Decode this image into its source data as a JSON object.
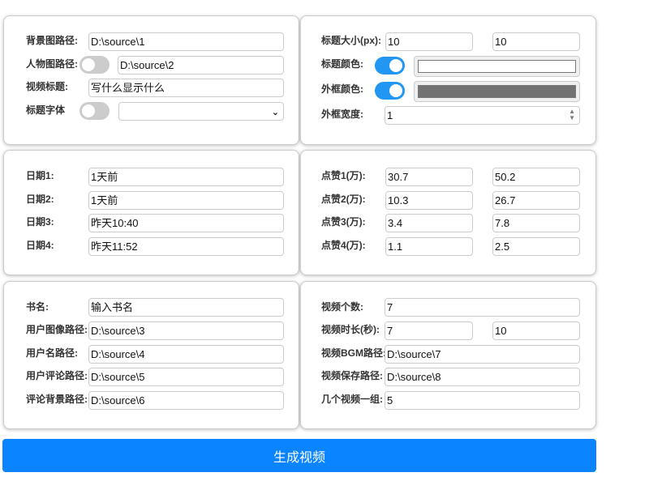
{
  "p1": {
    "bg_label": "背景图路径:",
    "bg_value": "D:\\source\\1",
    "person_label": "人物图路径:",
    "person_value": "D:\\source\\2",
    "title_label": "视频标题:",
    "title_value": "写什么显示什么",
    "font_label": "标题字体",
    "font_value": ""
  },
  "p2": {
    "size_label": "标题大小(px):",
    "size1": "10",
    "size2": "10",
    "color_label": "标题颜色:",
    "title_color": "#ffffff",
    "border_label": "外框颜色:",
    "border_color": "#727272",
    "width_label": "外框宽度:",
    "width_value": "1"
  },
  "p3": {
    "dates": [
      {
        "label": "日期1:",
        "value": "1天前"
      },
      {
        "label": "日期2:",
        "value": "1天前"
      },
      {
        "label": "日期3:",
        "value": "昨天10:40"
      },
      {
        "label": "日期4:",
        "value": "昨天11:52"
      }
    ]
  },
  "p4": {
    "likes": [
      {
        "label": "点赞1(万):",
        "a": "30.7",
        "b": "50.2"
      },
      {
        "label": "点赞2(万):",
        "a": "10.3",
        "b": "26.7"
      },
      {
        "label": "点赞3(万):",
        "a": "3.4",
        "b": "7.8"
      },
      {
        "label": "点赞4(万):",
        "a": "1.1",
        "b": "2.5"
      }
    ]
  },
  "p5": {
    "book_label": "书名:",
    "book_value": "输入书名",
    "avatar_label": "用户图像路径:",
    "avatar_value": "D:\\source\\3",
    "uname_label": "用户名路径:",
    "uname_value": "D:\\source\\4",
    "comment_label": "用户评论路径:",
    "comment_value": "D:\\source\\5",
    "cbg_label": "评论背景路径:",
    "cbg_value": "D:\\source\\6"
  },
  "p6": {
    "count_label": "视频个数:",
    "count_value": "7",
    "dur_label": "视频时长(秒):",
    "dur1": "7",
    "dur2": "10",
    "bgm_label": "视频BGM路径:",
    "bgm_value": "D:\\source\\7",
    "save_label": "视频保存路径:",
    "save_value": "D:\\source\\8",
    "group_label": "几个视频一组:",
    "group_value": "5"
  },
  "generate_label": "生成视频"
}
